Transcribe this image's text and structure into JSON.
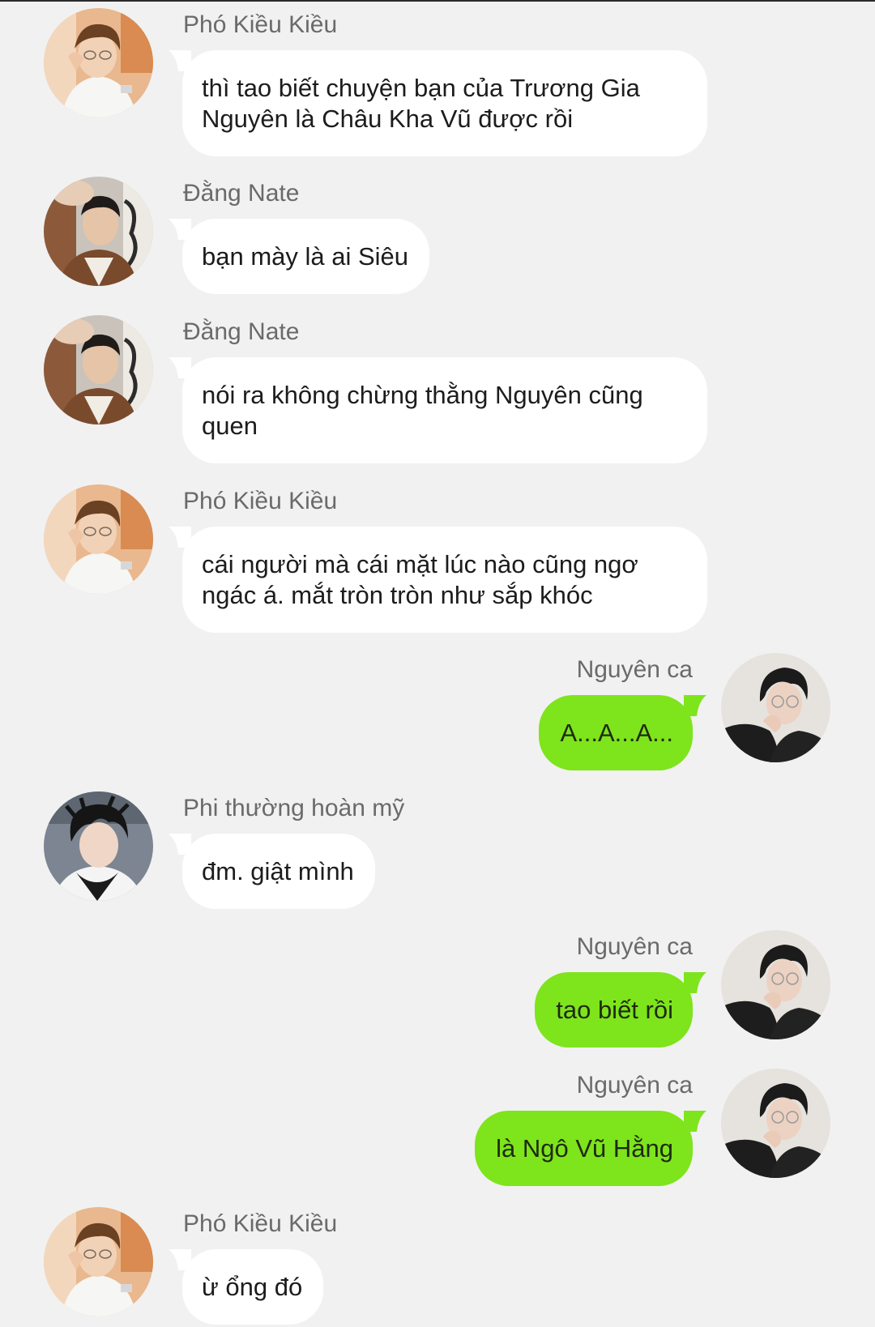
{
  "colors": {
    "background": "#f1f1f1",
    "incoming_bubble": "#ffffff",
    "outgoing_bubble": "#7ee41c",
    "sender_text": "#6a6a6a"
  },
  "messages": [
    {
      "direction": "incoming",
      "sender": "Phó Kiều Kiều",
      "avatar": "avatar-pho-kieu-kieu-icon",
      "text": "thì tao biết chuyện bạn của Trương Gia Nguyên là Châu Kha Vũ được rồi"
    },
    {
      "direction": "incoming",
      "sender": "Đằng Nate",
      "avatar": "avatar-dang-nate-icon",
      "text": "bạn mày là ai Siêu"
    },
    {
      "direction": "incoming",
      "sender": "Đằng Nate",
      "avatar": "avatar-dang-nate-icon",
      "text": "nói ra không chừng thằng Nguyên cũng quen"
    },
    {
      "direction": "incoming",
      "sender": "Phó Kiều Kiều",
      "avatar": "avatar-pho-kieu-kieu-icon",
      "text": "cái người mà cái mặt lúc nào cũng ngơ ngác á. mắt tròn tròn như sắp khóc"
    },
    {
      "direction": "outgoing",
      "sender": "Nguyên ca",
      "avatar": "avatar-nguyen-ca-icon",
      "text": "A...A...A..."
    },
    {
      "direction": "incoming",
      "sender": "Phi thường hoàn mỹ",
      "avatar": "avatar-phi-thuong-hoan-my-icon",
      "text": "đm. giật mình"
    },
    {
      "direction": "outgoing",
      "sender": "Nguyên ca",
      "avatar": "avatar-nguyen-ca-icon",
      "text": "tao biết rồi"
    },
    {
      "direction": "outgoing",
      "sender": "Nguyên ca",
      "avatar": "avatar-nguyen-ca-icon",
      "text": "là Ngô Vũ Hằng"
    },
    {
      "direction": "incoming",
      "sender": "Phó Kiều Kiều",
      "avatar": "avatar-pho-kieu-kieu-icon",
      "text": "ừ ổng đó"
    }
  ]
}
